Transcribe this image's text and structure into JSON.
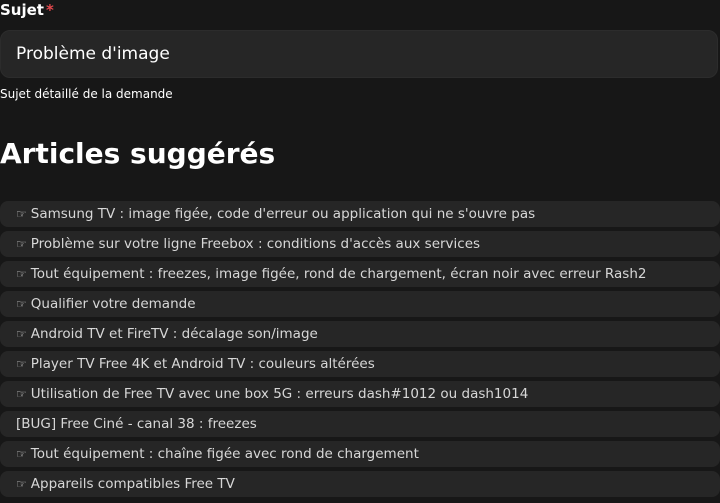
{
  "subject_field": {
    "label": "Sujet",
    "required_mark": "*",
    "value": "Problème d'image",
    "help_text": "Sujet détaillé de la demande"
  },
  "suggested_articles": {
    "title": "Articles suggérés",
    "pointer_glyph": "☞",
    "items": [
      {
        "label": "Samsung TV : image figée, code d'erreur ou application qui ne s'ouvre pas",
        "icon": "pointing-hand-icon"
      },
      {
        "label": "Problème sur votre ligne Freebox : conditions d'accès aux services",
        "icon": "pointing-hand-icon"
      },
      {
        "label": "Tout équipement : freezes, image figée, rond de chargement, écran noir avec erreur Rash2",
        "icon": "pointing-hand-icon"
      },
      {
        "label": "Qualifier votre demande",
        "icon": "pointing-hand-icon"
      },
      {
        "label": "Android TV et FireTV : décalage son/image",
        "icon": "pointing-hand-icon"
      },
      {
        "label": "Player TV Free 4K et Android TV : couleurs altérées",
        "icon": "pointing-hand-icon"
      },
      {
        "label": "Utilisation de Free TV avec une box 5G : erreurs dash#1012 ou dash1014",
        "icon": "pointing-hand-icon"
      },
      {
        "label": "[BUG] Free Ciné - canal 38 : freezes",
        "icon": null
      },
      {
        "label": "Tout équipement : chaîne figée avec rond de chargement",
        "icon": "pointing-hand-icon"
      },
      {
        "label": "Appareils compatibles Free TV",
        "icon": "pointing-hand-icon"
      }
    ]
  },
  "colors": {
    "background": "#171717",
    "surface": "#262626",
    "required": "#e5484d"
  }
}
